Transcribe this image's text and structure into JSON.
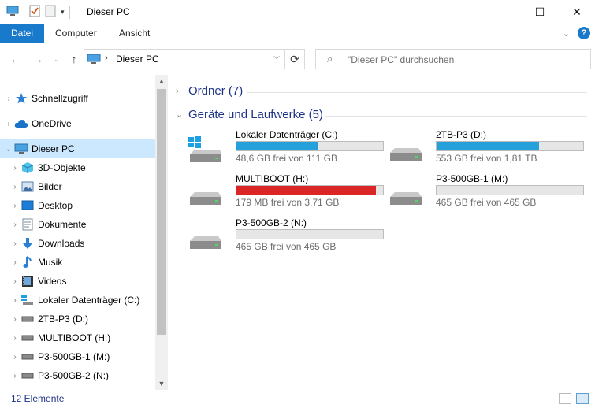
{
  "window": {
    "title": "Dieser PC",
    "minimize_glyph": "—",
    "maximize_glyph": "☐",
    "close_glyph": "✕"
  },
  "ribbon": {
    "tabs": [
      {
        "label": "Datei",
        "active": true
      },
      {
        "label": "Computer",
        "active": false
      },
      {
        "label": "Ansicht",
        "active": false
      }
    ],
    "help_label": "?"
  },
  "address": {
    "crumb": "Dieser PC",
    "search_placeholder": "\"Dieser PC\" durchsuchen"
  },
  "sidebar": {
    "items": [
      {
        "label": "Schnellzugriff",
        "icon": "star-icon"
      },
      {
        "label": "OneDrive",
        "icon": "cloud-icon"
      },
      {
        "label": "Dieser PC",
        "icon": "computer-icon",
        "selected": true
      },
      {
        "label": "3D-Objekte",
        "icon": "cube-icon"
      },
      {
        "label": "Bilder",
        "icon": "pictures-icon"
      },
      {
        "label": "Desktop",
        "icon": "desktop-icon"
      },
      {
        "label": "Dokumente",
        "icon": "documents-icon"
      },
      {
        "label": "Downloads",
        "icon": "download-arrow-icon"
      },
      {
        "label": "Musik",
        "icon": "music-note-icon"
      },
      {
        "label": "Videos",
        "icon": "film-icon"
      },
      {
        "label": "Lokaler Datenträger (C:)",
        "icon": "windows-drive-icon"
      },
      {
        "label": "2TB-P3 (D:)",
        "icon": "drive-icon"
      },
      {
        "label": "MULTIBOOT (H:)",
        "icon": "drive-icon"
      },
      {
        "label": "P3-500GB-1 (M:)",
        "icon": "drive-icon"
      },
      {
        "label": "P3-500GB-2 (N:)",
        "icon": "drive-icon"
      }
    ]
  },
  "content": {
    "folders_header": "Ordner (7)",
    "drives_header": "Geräte und Laufwerke (5)",
    "drives": [
      {
        "name": "Lokaler Datenträger (C:)",
        "free": "48,6 GB frei von 111 GB",
        "used_fraction": 0.56,
        "critical": false,
        "os": true
      },
      {
        "name": "2TB-P3 (D:)",
        "free": "553 GB frei von 1,81 TB",
        "used_fraction": 0.7,
        "critical": false,
        "os": false
      },
      {
        "name": "MULTIBOOT (H:)",
        "free": "179 MB frei von 3,71 GB",
        "used_fraction": 0.953,
        "critical": true,
        "os": false
      },
      {
        "name": "P3-500GB-1 (M:)",
        "free": "465 GB frei von 465 GB",
        "used_fraction": 0.0,
        "critical": false,
        "os": false
      },
      {
        "name": "P3-500GB-2 (N:)",
        "free": "465 GB frei von 465 GB",
        "used_fraction": 0.0,
        "critical": false,
        "os": false
      }
    ]
  },
  "status": {
    "count": "12 Elemente"
  },
  "colors": {
    "accent": "#1979ca",
    "bar_normal": "#26a0da",
    "bar_critical": "#da2626",
    "selection": "#cce8ff"
  }
}
